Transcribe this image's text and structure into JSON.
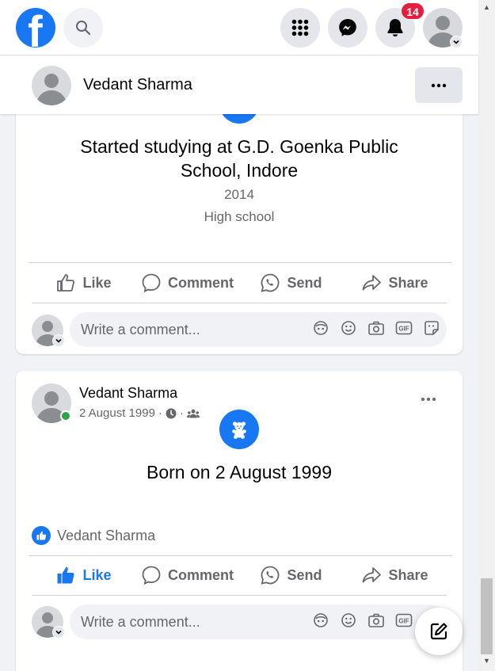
{
  "topnav": {
    "logo_letter": "f",
    "notifications_count": "14",
    "icons": [
      "facebook-logo",
      "search-icon",
      "menu-grid-icon",
      "messenger-icon",
      "bell-icon",
      "avatar"
    ]
  },
  "profile_bar": {
    "name": "Vedant Sharma",
    "more": "···"
  },
  "card1": {
    "title": "Started studying at G.D. Goenka Public School, Indore",
    "year": "2014",
    "category": "High school",
    "actions": {
      "like": "Like",
      "comment": "Comment",
      "send": "Send",
      "share": "Share"
    },
    "comment_placeholder": "Write a comment..."
  },
  "card2": {
    "author": "Vedant Sharma",
    "date": "2 August 1999",
    "meta_sep": "·",
    "title": "Born on 2 August 1999",
    "reaction_name": "Vedant Sharma",
    "actions": {
      "like": "Like",
      "comment": "Comment",
      "send": "Send",
      "share": "Share"
    },
    "comment_placeholder": "Write a comment...",
    "like_active": true
  },
  "colors": {
    "brand": "#1877f2",
    "badge": "#e41e3f",
    "online": "#31a24c",
    "muted_text": "#65676b"
  }
}
